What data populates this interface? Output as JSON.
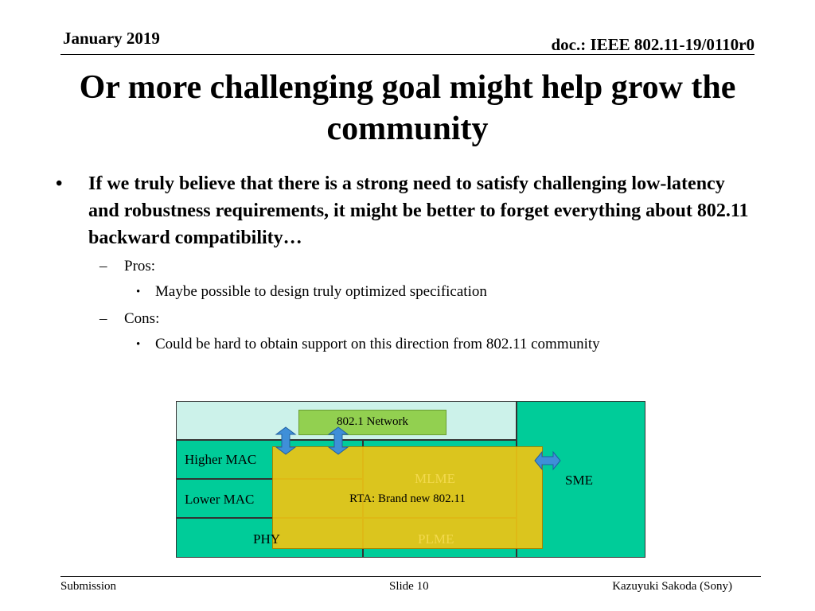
{
  "header": {
    "date": "January 2019",
    "doc_id": "doc.: IEEE 802.11-19/0110r0"
  },
  "title": "Or more challenging goal might help grow the community",
  "bullets": {
    "main": "If we truly believe that there is a strong need to satisfy challenging low-latency and robustness requirements, it might be better to forget everything about 802.11 backward compatibility…",
    "main_marker": "•",
    "dash_marker": "–",
    "sub_marker": "•",
    "pros_label": "Pros:",
    "pros_item": "Maybe possible to design truly optimized specification",
    "cons_label": "Cons:",
    "cons_item": "Could be hard to obtain support on this direction from 802.11 community"
  },
  "diagram": {
    "network": "802.1 Network",
    "higher_mac": "Higher MAC",
    "lower_mac": "Lower MAC",
    "phy": "PHY",
    "mlme": "MLME",
    "plme": "PLME",
    "sme": "SME",
    "rta": "RTA: Brand new 802.11",
    "colors": {
      "teal": "#00cc99",
      "light_teal": "#ccf2ea",
      "green_box": "#92d050",
      "overlay": "#e8c21a",
      "overlay_border": "#a88400",
      "arrow": "#3f8fd8"
    }
  },
  "footer": {
    "submission": "Submission",
    "slide": "Slide 10",
    "author": "Kazuyuki Sakoda (Sony)"
  }
}
